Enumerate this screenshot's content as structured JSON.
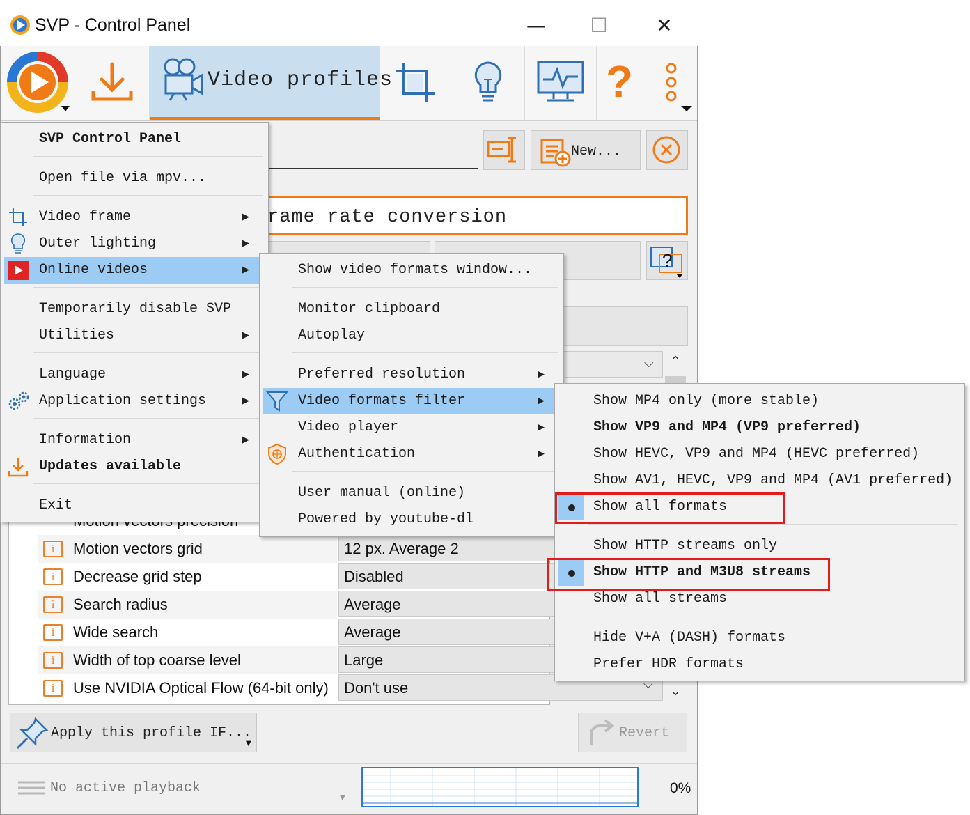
{
  "window": {
    "title": "SVP - Control Panel",
    "minimize": "—",
    "maximize": "☐",
    "close": "✕"
  },
  "toolbar": {
    "active_tab_label": "Video profiles"
  },
  "profile_panel": {
    "new_button": "New...",
    "orange_field_text": "rame rate conversion"
  },
  "table_rows": [
    {
      "label": "Motion vectors precision",
      "value": ""
    },
    {
      "label": "Motion vectors grid",
      "value": "12 px. Average 2"
    },
    {
      "label": "Decrease grid step",
      "value": "Disabled"
    },
    {
      "label": "Search radius",
      "value": "Average"
    },
    {
      "label": "Wide search",
      "value": "Average"
    },
    {
      "label": "Width of top coarse level",
      "value": "Large"
    },
    {
      "label": "Use NVIDIA Optical Flow (64-bit only)",
      "value": "Don't use"
    }
  ],
  "bottom": {
    "apply_label": "Apply this profile IF...",
    "revert_label": "Revert",
    "status_text": "No active playback",
    "percent": "0%"
  },
  "main_menu": {
    "header": "SVP Control Panel",
    "items": [
      {
        "label": "Open file via mpv..."
      },
      {
        "label": "Video frame"
      },
      {
        "label": "Outer lighting"
      },
      {
        "label": "Online videos"
      },
      {
        "label": "Temporarily disable SVP"
      },
      {
        "label": "Utilities"
      },
      {
        "label": "Language"
      },
      {
        "label": "Application settings"
      },
      {
        "label": "Information"
      },
      {
        "label": "Updates available"
      },
      {
        "label": "Exit"
      }
    ]
  },
  "online_menu": {
    "items": [
      {
        "label": "Show video formats window..."
      },
      {
        "label": "Monitor clipboard"
      },
      {
        "label": "Autoplay"
      },
      {
        "label": "Preferred resolution"
      },
      {
        "label": "Video formats filter"
      },
      {
        "label": "Video player"
      },
      {
        "label": "Authentication"
      },
      {
        "label": "User manual (online)"
      },
      {
        "label": "Powered by youtube-dl"
      }
    ]
  },
  "filter_menu": {
    "items": [
      {
        "label": "Show MP4 only (more stable)"
      },
      {
        "label": "Show VP9 and MP4 (VP9 preferred)"
      },
      {
        "label": "Show HEVC, VP9 and MP4 (HEVC preferred)"
      },
      {
        "label": "Show AV1, HEVC, VP9 and MP4 (AV1 preferred)"
      },
      {
        "label": "Show all formats"
      },
      {
        "label": "Show HTTP streams only"
      },
      {
        "label": "Show HTTP and M3U8 streams"
      },
      {
        "label": "Show all streams"
      },
      {
        "label": "Hide V+A (DASH) formats"
      },
      {
        "label": "Prefer HDR formats"
      }
    ]
  },
  "colors": {
    "accent": "#f07a16",
    "highlight": "#9ccbf4",
    "annotation_red": "#e21b1b"
  }
}
